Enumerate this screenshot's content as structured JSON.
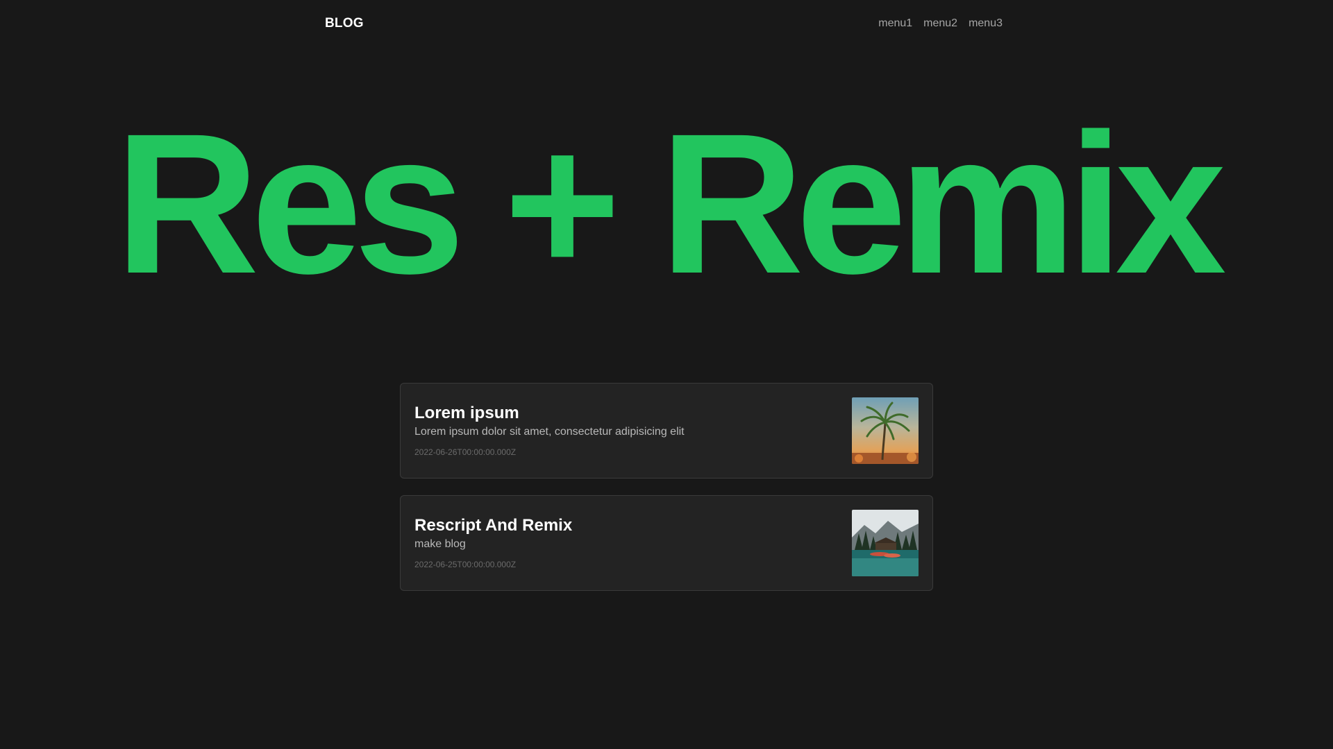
{
  "nav": {
    "brand": "BLOG",
    "menu": [
      "menu1",
      "menu2",
      "menu3"
    ]
  },
  "hero": {
    "title": "Res + Remix"
  },
  "posts": [
    {
      "title": "Lorem ipsum",
      "description": "Lorem ipsum dolor sit amet, consectetur adipisicing elit",
      "date": "2022-06-26T00:00:00.000Z",
      "thumbnail": "palm-tree-sunset-image"
    },
    {
      "title": "Rescript And Remix",
      "description": "make blog",
      "date": "2022-06-25T00:00:00.000Z",
      "thumbnail": "mountain-lake-lodge-image"
    }
  ],
  "colors": {
    "background": "#181818",
    "accent": "#22c55e",
    "card": "#232323"
  }
}
